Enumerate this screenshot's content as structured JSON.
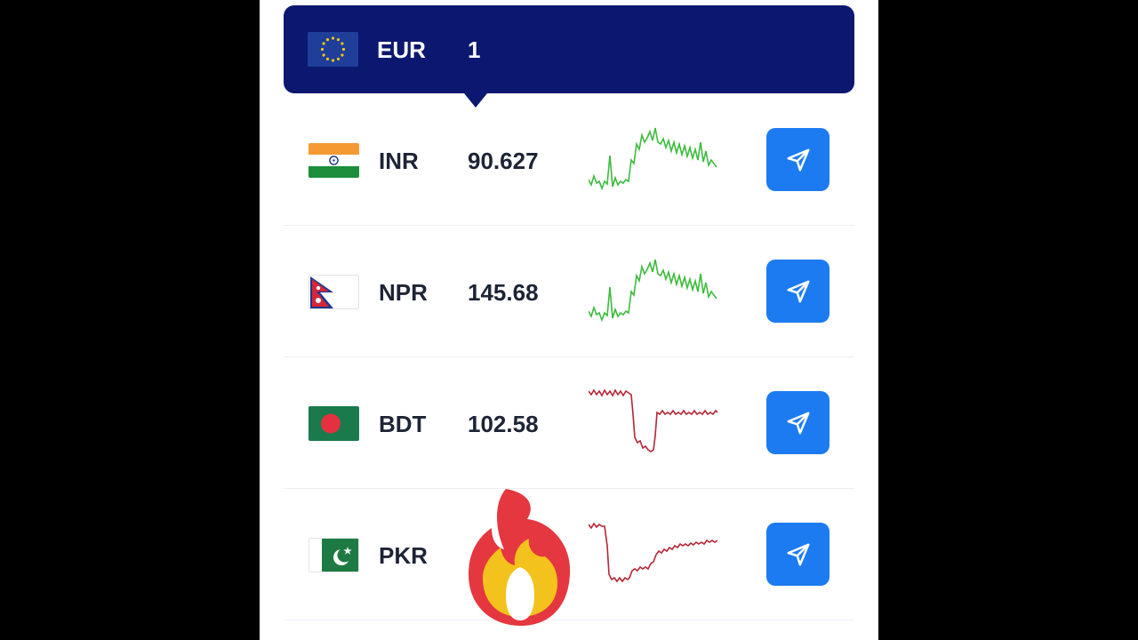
{
  "base": {
    "code": "EUR",
    "rate": "1",
    "flag_icon": "eu-flag-icon",
    "color": "#0c1870"
  },
  "rows": [
    {
      "code": "INR",
      "rate": "90.627",
      "flag_icon": "india-flag-icon",
      "trend": "up",
      "trend_color": "#3dbb3d"
    },
    {
      "code": "NPR",
      "rate": "145.68",
      "flag_icon": "nepal-flag-icon",
      "trend": "up",
      "trend_color": "#3dbb3d"
    },
    {
      "code": "BDT",
      "rate": "102.58",
      "flag_icon": "bangladesh-flag-icon",
      "trend": "down",
      "trend_color": "#b52636"
    },
    {
      "code": "PKR",
      "rate": "",
      "flag_icon": "pakistan-flag-icon",
      "trend": "down",
      "trend_color": "#b52636"
    }
  ],
  "send_button": {
    "icon": "send-icon",
    "color": "#1c7bf0"
  },
  "overlay": {
    "icon": "fire-emoji-icon"
  }
}
